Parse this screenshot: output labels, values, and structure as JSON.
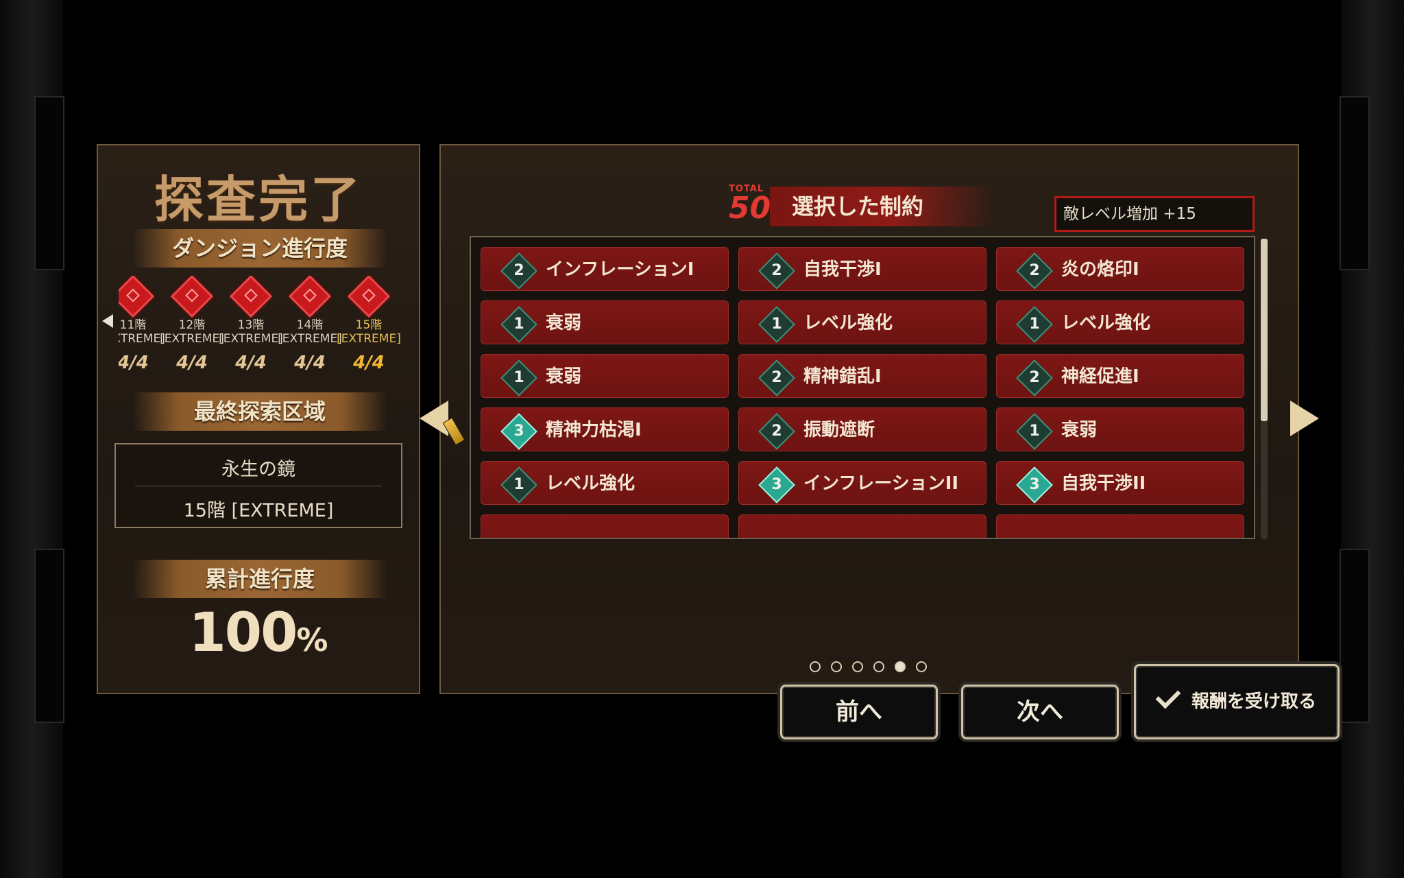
{
  "summary": {
    "title": "探査完了",
    "dungeon_progress_label": "ダンジョン進行度",
    "floors": [
      {
        "name": "11階",
        "difficulty": "[EXTREME]",
        "progress": "4/4",
        "current": false
      },
      {
        "name": "12階",
        "difficulty": "[EXTREME]",
        "progress": "4/4",
        "current": false
      },
      {
        "name": "13階",
        "difficulty": "[EXTREME]",
        "progress": "4/4",
        "current": false
      },
      {
        "name": "14階",
        "difficulty": "[EXTREME]",
        "progress": "4/4",
        "current": false
      },
      {
        "name": "15階",
        "difficulty": "[EXTREME]",
        "progress": "4/4",
        "current": true
      }
    ],
    "final_area_label": "最終探索区域",
    "final_area_name": "永生の鏡",
    "final_area_floor": "15階 [EXTREME]",
    "cumulative_label": "累計進行度",
    "cumulative_value": "100",
    "cumulative_unit": "%"
  },
  "constraints": {
    "total_label": "TOTAL",
    "total_value": "50",
    "title": "選択した制約",
    "enemy_level": "敵レベル増加 +15",
    "cards": [
      {
        "level": "2",
        "name": "インフレーションI"
      },
      {
        "level": "2",
        "name": "自我干渉I"
      },
      {
        "level": "2",
        "name": "炎の烙印I"
      },
      {
        "level": "1",
        "name": "衰弱"
      },
      {
        "level": "1",
        "name": "レベル強化"
      },
      {
        "level": "1",
        "name": "レベル強化"
      },
      {
        "level": "1",
        "name": "衰弱"
      },
      {
        "level": "2",
        "name": "精神錯乱I"
      },
      {
        "level": "2",
        "name": "神経促進I"
      },
      {
        "level": "3",
        "name": "精神力枯渇I"
      },
      {
        "level": "2",
        "name": "振動遮断"
      },
      {
        "level": "1",
        "name": "衰弱"
      },
      {
        "level": "1",
        "name": "レベル強化"
      },
      {
        "level": "3",
        "name": "インフレーションII"
      },
      {
        "level": "3",
        "name": "自我干渉II"
      }
    ],
    "page_count": 6,
    "active_page": 5
  },
  "buttons": {
    "prev": "前へ",
    "next": "次へ",
    "claim": "報酬を受け取る"
  },
  "colors": {
    "card_red": "#7e1715",
    "gem_teal": "#3d8f78",
    "accent_gold": "#e8c050",
    "highlight_red": "#b21a18"
  }
}
